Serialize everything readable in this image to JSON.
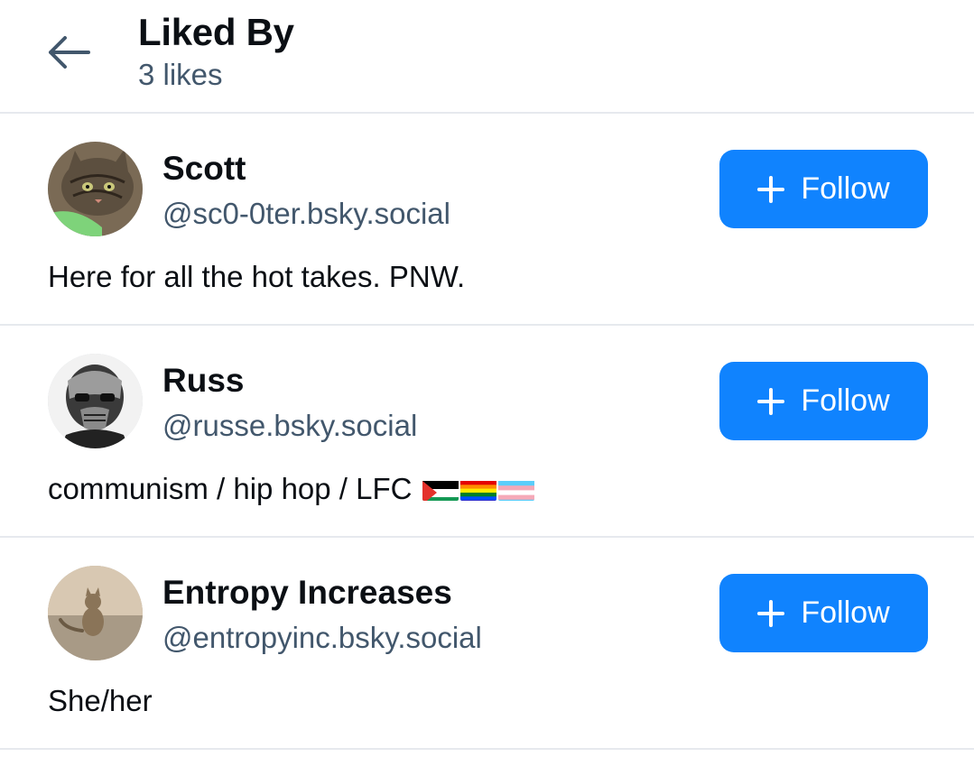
{
  "header": {
    "title": "Liked By",
    "subtitle": "3 likes"
  },
  "users": [
    {
      "name": "Scott",
      "handle": "@sc0-0ter.bsky.social",
      "bio": "Here for all the hot takes. PNW.",
      "follow_label": "Follow",
      "avatar_icon": "cat-avatar-icon"
    },
    {
      "name": "Russ",
      "handle": "@russe.bsky.social",
      "bio": "communism / hip hop / LFC",
      "bio_flags": [
        "palestine-flag-icon",
        "rainbow-flag-icon",
        "transgender-flag-icon"
      ],
      "follow_label": "Follow",
      "avatar_icon": "masked-face-avatar-icon"
    },
    {
      "name": "Entropy Increases",
      "handle": "@entropyinc.bsky.social",
      "bio": "She/her",
      "follow_label": "Follow",
      "avatar_icon": "cat-avatar-icon"
    }
  ],
  "colors": {
    "accent": "#1083fe",
    "secondary_text": "#42576c",
    "divider": "#e6e9ee"
  }
}
